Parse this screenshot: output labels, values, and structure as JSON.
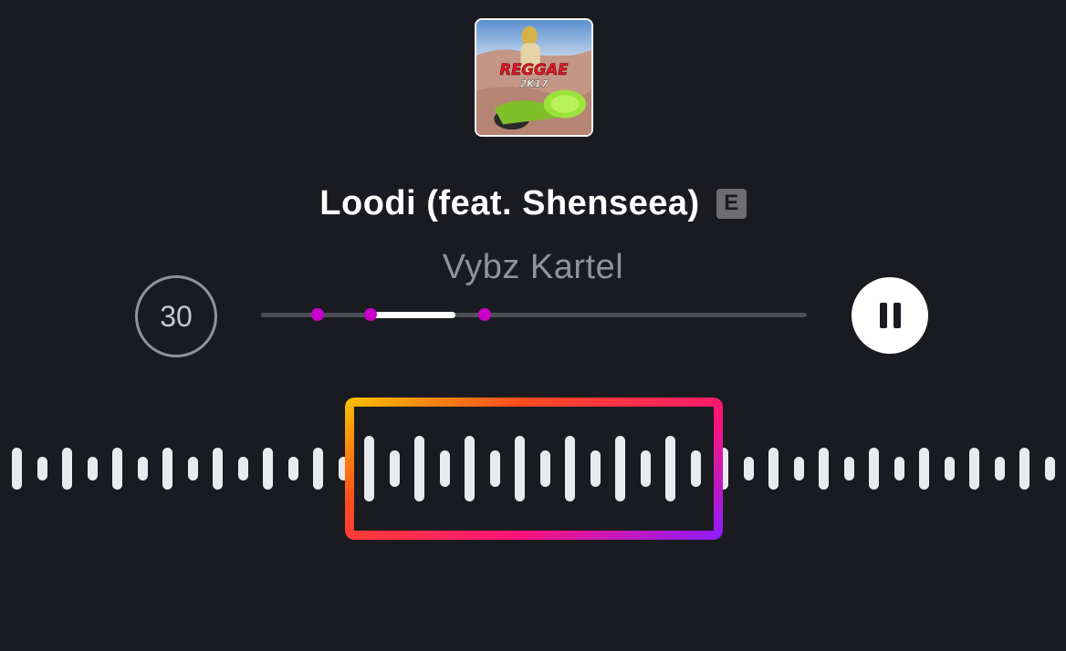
{
  "track": {
    "title": "Loodi (feat. Shenseea)",
    "explicit_label": "E",
    "artist": "Vybz Kartel",
    "album_art": {
      "word": "REGGAE",
      "subtitle": "2K17"
    }
  },
  "controls": {
    "skip_label": "30",
    "pause_icon": "pause-icon"
  },
  "progress": {
    "selection_start_fraction": 0.2,
    "selection_end_fraction": 0.356,
    "markers": [
      0.103,
      0.2,
      0.41
    ]
  },
  "colors": {
    "background": "#1a1b20",
    "marker": "#c800c8",
    "track": "#4c4f57",
    "selection": "#ffffff",
    "bar": "#e9eaee",
    "clip_gradient": [
      "#f7c300",
      "#ff4b1f",
      "#ff1477",
      "#8a1cff"
    ]
  },
  "waveform": {
    "bars_inside_clip_pattern": [
      "tall",
      "short"
    ],
    "bars_outside_clip_pattern": [
      "tall",
      "short"
    ]
  }
}
